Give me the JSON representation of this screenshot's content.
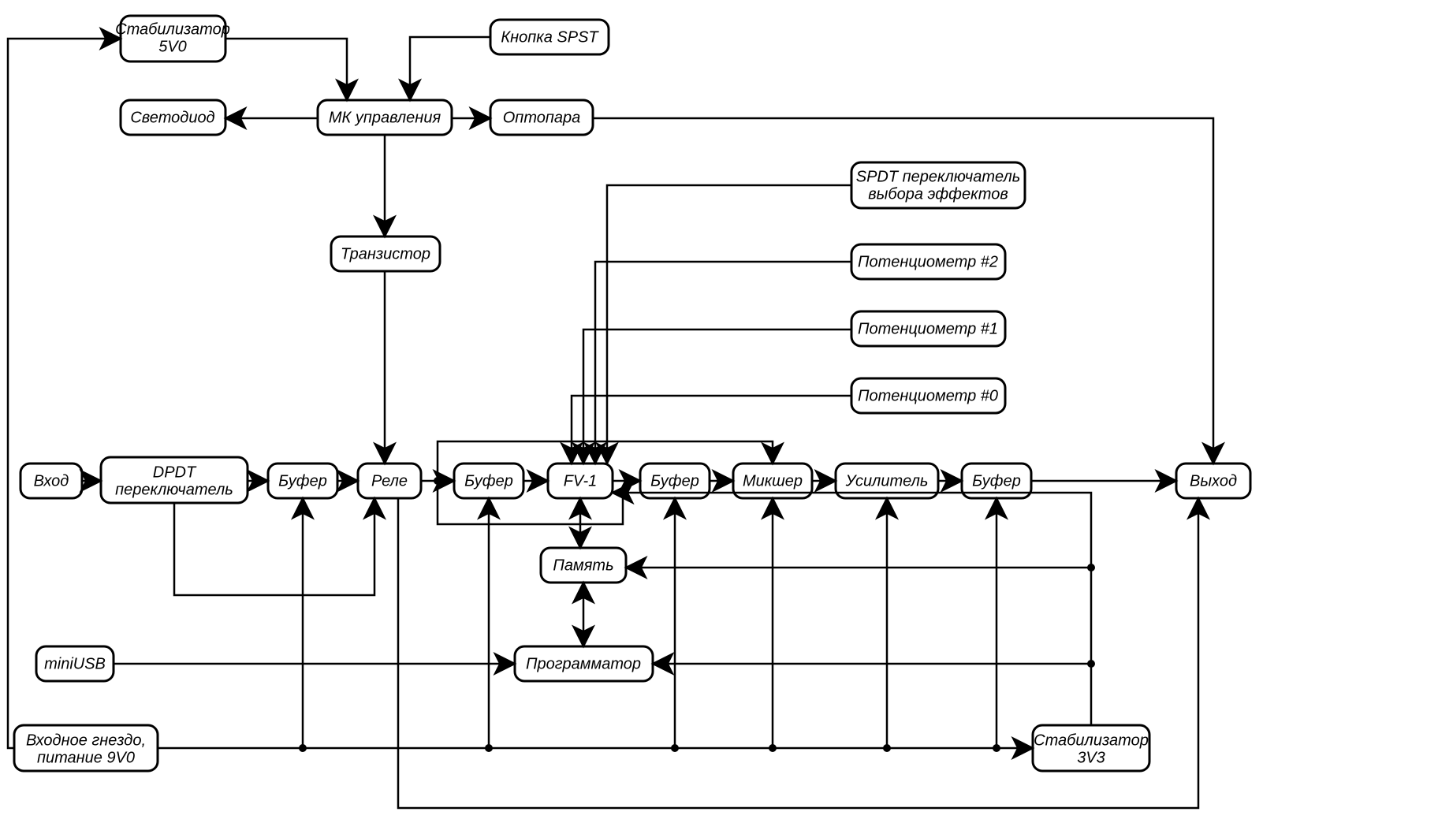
{
  "nodes": {
    "stab5v0": {
      "l1": "Стабилизатор",
      "l2": "5V0"
    },
    "spst": {
      "l1": "Кнопка SPST"
    },
    "led": {
      "l1": "Светодиод"
    },
    "mcu": {
      "l1": "МК управления"
    },
    "opto": {
      "l1": "Оптопара"
    },
    "trans": {
      "l1": "Транзистор"
    },
    "spdt_eff": {
      "l1": "SPDT переключатель",
      "l2": "выбора эффектов"
    },
    "pot2": {
      "l1": "Потенциометр #2"
    },
    "pot1": {
      "l1": "Потенциометр #1"
    },
    "pot0": {
      "l1": "Потенциометр #0"
    },
    "input": {
      "l1": "Вход"
    },
    "dpdt": {
      "l1": "DPDT",
      "l2": "переключатель"
    },
    "buf1": {
      "l1": "Буфер"
    },
    "relay": {
      "l1": "Реле"
    },
    "buf2": {
      "l1": "Буфер"
    },
    "fv1": {
      "l1": "FV-1"
    },
    "buf3": {
      "l1": "Буфер"
    },
    "mixer": {
      "l1": "Микшер"
    },
    "amp": {
      "l1": "Усилитель"
    },
    "buf4": {
      "l1": "Буфер"
    },
    "output": {
      "l1": "Выход"
    },
    "mem": {
      "l1": "Память"
    },
    "miniusb": {
      "l1": "miniUSB"
    },
    "prog": {
      "l1": "Программатор"
    },
    "pwr9v": {
      "l1": "Входное гнездо,",
      "l2": "питание 9V0"
    },
    "stab3v3": {
      "l1": "Стабилизатор",
      "l2": "3V3"
    }
  }
}
